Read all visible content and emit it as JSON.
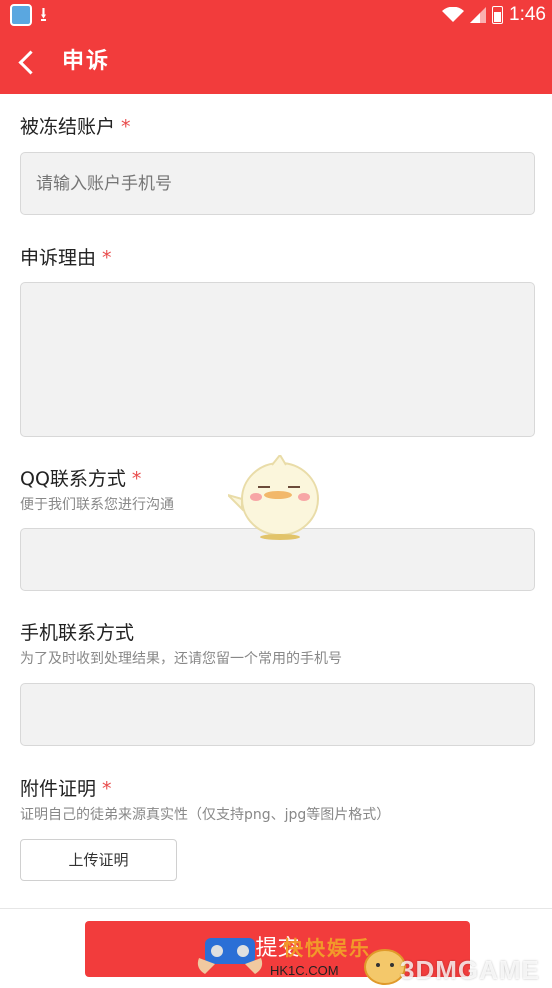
{
  "status_bar": {
    "time": "1:46"
  },
  "header": {
    "title": "申诉"
  },
  "form": {
    "account": {
      "label": "被冻结账户",
      "required": "*",
      "placeholder": "请输入账户手机号"
    },
    "reason": {
      "label": "申诉理由",
      "required": "*"
    },
    "qq": {
      "label": "QQ联系方式",
      "required": "*",
      "hint": "便于我们联系您进行沟通"
    },
    "phone": {
      "label": "手机联系方式",
      "hint": "为了及时收到处理结果，还请您留一个常用的手机号"
    },
    "attachment": {
      "label": "附件证明",
      "required": "*",
      "hint": "证明自己的徒弟来源真实性（仅支持png、jpg等图片格式）",
      "upload_label": "上传证明"
    },
    "submit_label": "提交"
  },
  "watermark": {
    "brand": "快快娱乐",
    "site": "HK1C.COM",
    "right": "3DMGAME"
  },
  "colors": {
    "primary": "#f23c3c",
    "required": "#e84a4a",
    "input_bg": "#f2f2f2"
  }
}
